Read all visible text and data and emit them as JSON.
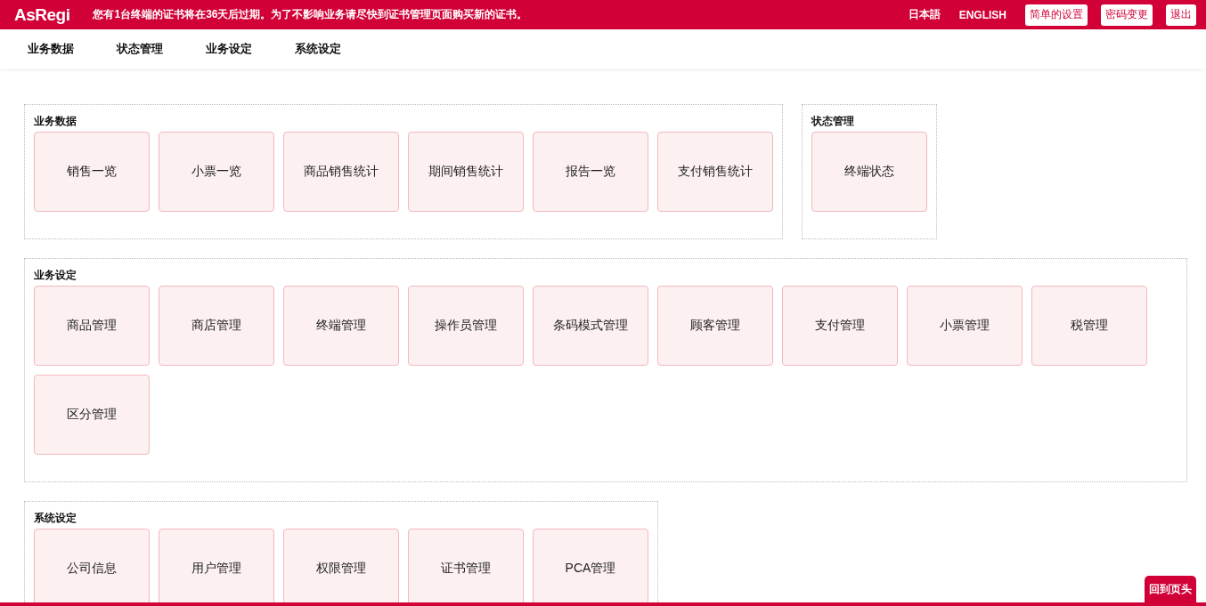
{
  "header": {
    "logo": "AsRegi",
    "notice": "您有1台终端的证书将在36天后过期。为了不影响业务请尽快到证书管理页面购买新的证书。",
    "languages": [
      "日本語",
      "ENGLISH"
    ],
    "buttons": [
      "简单的设置",
      "密码变更",
      "退出"
    ]
  },
  "nav": {
    "items": [
      "业务数据",
      "状态管理",
      "业务设定",
      "系统设定"
    ]
  },
  "sections": [
    {
      "title": "业务数据",
      "tiles": [
        "销售一览",
        "小票一览",
        "商品销售统计",
        "期间销售统计",
        "报告一览",
        "支付销售统计"
      ]
    },
    {
      "title": "状态管理",
      "tiles": [
        "终端状态"
      ]
    },
    {
      "title": "业务设定",
      "tiles": [
        "商品管理",
        "商店管理",
        "终端管理",
        "操作员管理",
        "条码模式管理",
        "顾客管理",
        "支付管理",
        "小票管理",
        "税管理",
        "区分管理"
      ]
    },
    {
      "title": "系统设定",
      "tiles": [
        "公司信息",
        "用户管理",
        "权限管理",
        "证书管理",
        "PCA管理"
      ]
    }
  ],
  "back_to_top": "回到页头"
}
